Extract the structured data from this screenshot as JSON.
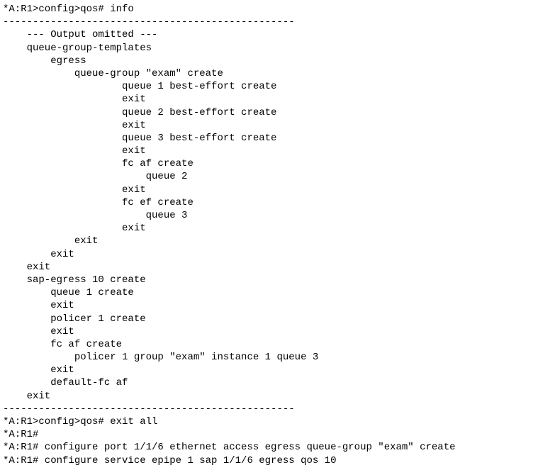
{
  "lines": [
    "*A:R1>config>qos# info",
    "-------------------------------------------------",
    "    --- Output omitted ---",
    "    queue-group-templates",
    "        egress",
    "            queue-group \"exam\" create",
    "                    queue 1 best-effort create",
    "                    exit",
    "                    queue 2 best-effort create",
    "                    exit",
    "                    queue 3 best-effort create",
    "                    exit",
    "                    fc af create",
    "                        queue 2",
    "                    exit",
    "                    fc ef create",
    "                        queue 3",
    "                    exit",
    "            exit",
    "        exit",
    "    exit",
    "    sap-egress 10 create",
    "        queue 1 create",
    "        exit",
    "        policer 1 create",
    "        exit",
    "        fc af create",
    "            policer 1 group \"exam\" instance 1 queue 3",
    "        exit",
    "        default-fc af",
    "    exit",
    "-------------------------------------------------",
    "*A:R1>config>qos# exit all",
    "*A:R1#",
    "*A:R1# configure port 1/1/6 ethernet access egress queue-group \"exam\" create",
    "*A:R1# configure service epipe 1 sap 1/1/6 egress qos 10"
  ]
}
